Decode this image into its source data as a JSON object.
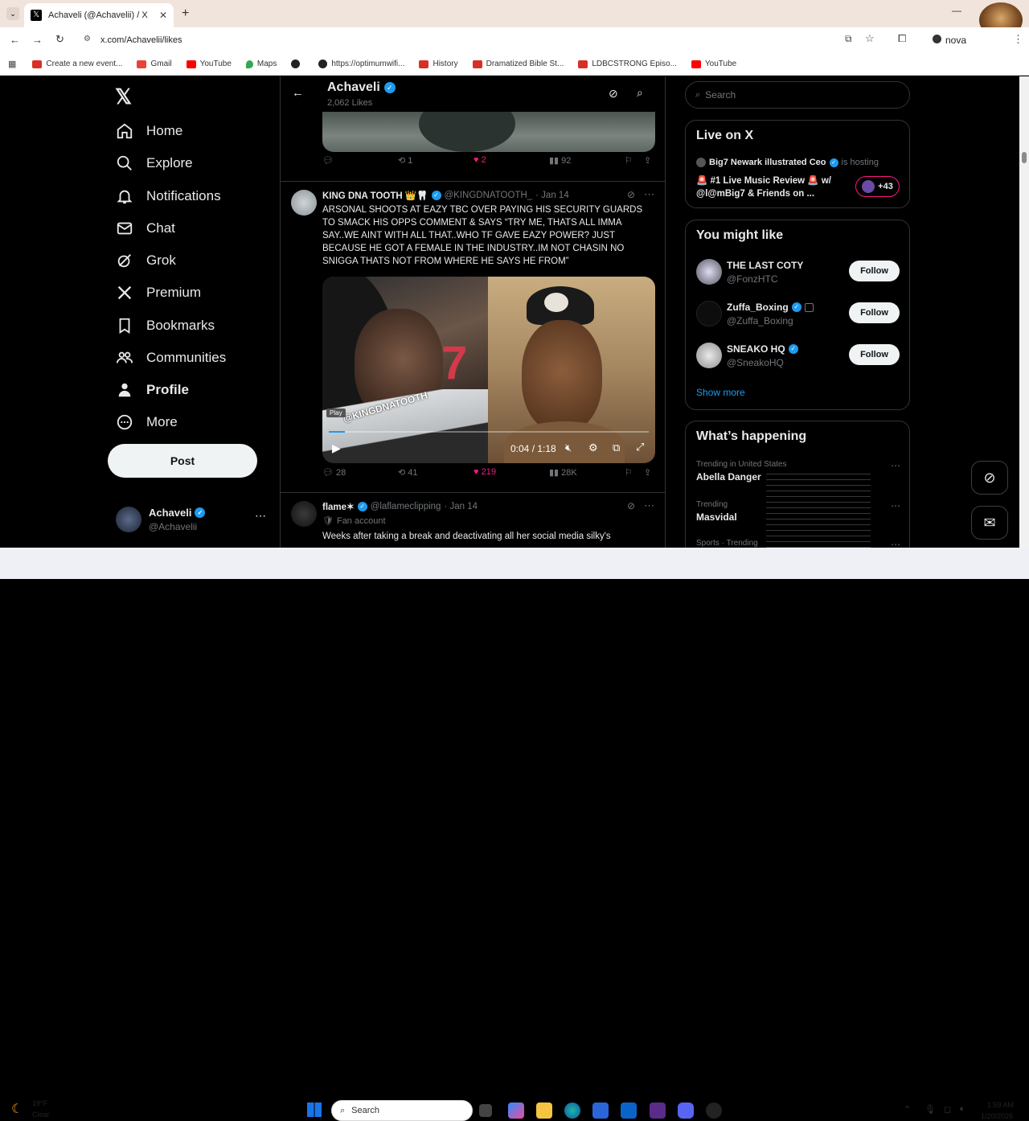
{
  "browser": {
    "tab_title": "Achaveli (@Achavelii) / X",
    "url": "x.com/Achavelii/likes",
    "profile_label": "nova",
    "bookmarks": [
      "Create a new event...",
      "Gmail",
      "YouTube",
      "Maps",
      "",
      "https://optimumwifi...",
      "History",
      "Dramatized Bible St...",
      "LDBCSTRONG Episo...",
      "YouTube"
    ]
  },
  "nav": {
    "items": [
      "Home",
      "Explore",
      "Notifications",
      "Chat",
      "Grok",
      "Premium",
      "Bookmarks",
      "Communities",
      "Profile",
      "More"
    ],
    "post_label": "Post",
    "account_name": "Achaveli",
    "account_handle": "@Achavelii"
  },
  "header": {
    "name": "Achaveli",
    "subtitle": "2,062 Likes"
  },
  "tweet1": {
    "replies": "",
    "retweets": "1",
    "likes": "2",
    "views": "92"
  },
  "tweet2": {
    "name": "KING DNA TOOTH 👑🦷",
    "handle": "@KINGDNATOOTH_",
    "date": "· Jan 14",
    "text": "ARSONAL SHOOTS AT EAZY TBC OVER PAYING HIS SECURITY GUARDS TO SMACK HIS OPPS COMMENT & SAYS “TRY ME, THATS ALL IMMA SAY..WE AINT WITH ALL THAT..WHO TF GAVE EAZY POWER? JUST BECAUSE HE GOT A FEMALE IN THE INDUSTRY..IM NOT CHASIN NO SNIGGA THATS NOT FROM WHERE HE SAYS HE FROM”",
    "video_watermark": "@KINGDNATOOTH",
    "video_tooltip": "Play",
    "video_time": "0:04 / 1:18",
    "video_progress": 0.05,
    "replies": "28",
    "retweets": "41",
    "likes": "219",
    "views": "28K"
  },
  "tweet3": {
    "name": "flame✶",
    "handle": "@laflameclipping",
    "date": "· Jan 14",
    "badge": "Fan account",
    "text": "Weeks after taking a break and deactivating all her social media silky's"
  },
  "right": {
    "search_placeholder": "Search",
    "live_title": "Live on X",
    "live_host": "Big7 Newark illustrated Ceo",
    "live_hosting": "is hosting",
    "live_desc": "🚨 #1 Live Music Review 🚨 w/ @l@mBig7 & Friends on ...",
    "live_count": "+43",
    "wtf_title": "You might like",
    "suggestions": [
      {
        "name": "THE LAST COTY",
        "handle": "@FonzHTC",
        "button": "Follow"
      },
      {
        "name": "Zuffa_Boxing",
        "handle": "@Zuffa_Boxing",
        "button": "Follow"
      },
      {
        "name": "SNEAKO HQ",
        "handle": "@SneakoHQ",
        "button": "Follow"
      }
    ],
    "show_more": "Show more",
    "happening_title": "What’s happening",
    "trends": [
      {
        "context": "Trending in United States",
        "topic": "Abella Danger"
      },
      {
        "context": "Trending",
        "topic": "Masvidal"
      },
      {
        "context": "Sports · Trending",
        "topic": ""
      }
    ]
  },
  "taskbar": {
    "weather_temp": "19°F",
    "weather_desc": "Clear",
    "search": "Search",
    "time": "1:59 AM",
    "date": "1/20/2026"
  },
  "colors": {
    "like": "#f91880",
    "verified": "#1d9bf0",
    "bg": "#000000"
  }
}
